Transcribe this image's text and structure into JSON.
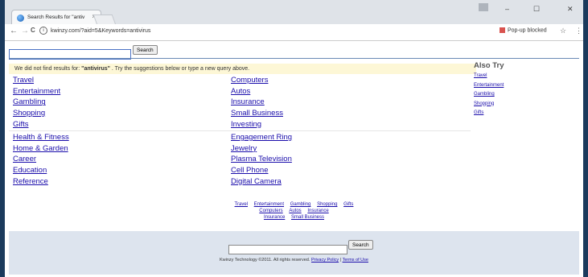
{
  "browser": {
    "tab_title": "Search Results for \"antiv",
    "tab_close": "×",
    "profile": "👤",
    "minimize": "–",
    "maximize": "☐",
    "close": "✕",
    "back": "←",
    "forward": "→",
    "reload": "C",
    "url": "kwinzy.com/?aid=5&Keywords=antivirus",
    "popup_blocked": "Pop-up blocked",
    "star": "☆",
    "menu": "⋮"
  },
  "search": {
    "value": "",
    "button": "Search"
  },
  "notice": {
    "prefix": "We did not find results for: ",
    "query": "\"antivirus\"",
    "suffix": " . Try the suggestions below or type a new query above."
  },
  "left_links": [
    "Travel",
    "Entertainment",
    "Gambling",
    "Shopping",
    "Gifts"
  ],
  "left_links2": [
    "Health & Fitness",
    "Home & Garden",
    "Career",
    "Education",
    "Reference"
  ],
  "right_links": [
    "Computers",
    "Autos",
    "Insurance",
    "Small Business",
    "Investing"
  ],
  "right_links2": [
    "Engagement Ring",
    "Jewelry",
    "Plasma Television",
    "Cell Phone",
    "Digital Camera"
  ],
  "also_try": {
    "heading": "Also Try",
    "links": [
      "Travel",
      "Entertainment",
      "Gambling",
      "Shopping",
      "Gifts"
    ]
  },
  "bottom_links": {
    "row1": [
      "Travel",
      "Entertainment",
      "Gambling",
      "Shopping",
      "Gifts"
    ],
    "row2": [
      "Computers",
      "Autos",
      "Insurance"
    ],
    "row3": [
      "Insurance",
      "Small Business"
    ]
  },
  "footer": {
    "search_button": "Search",
    "copyright": "Kwinzy Technology ©2011. All rights reserved. ",
    "privacy": "Privacy Policy",
    "separator": " | ",
    "terms": "Terms of Use"
  }
}
